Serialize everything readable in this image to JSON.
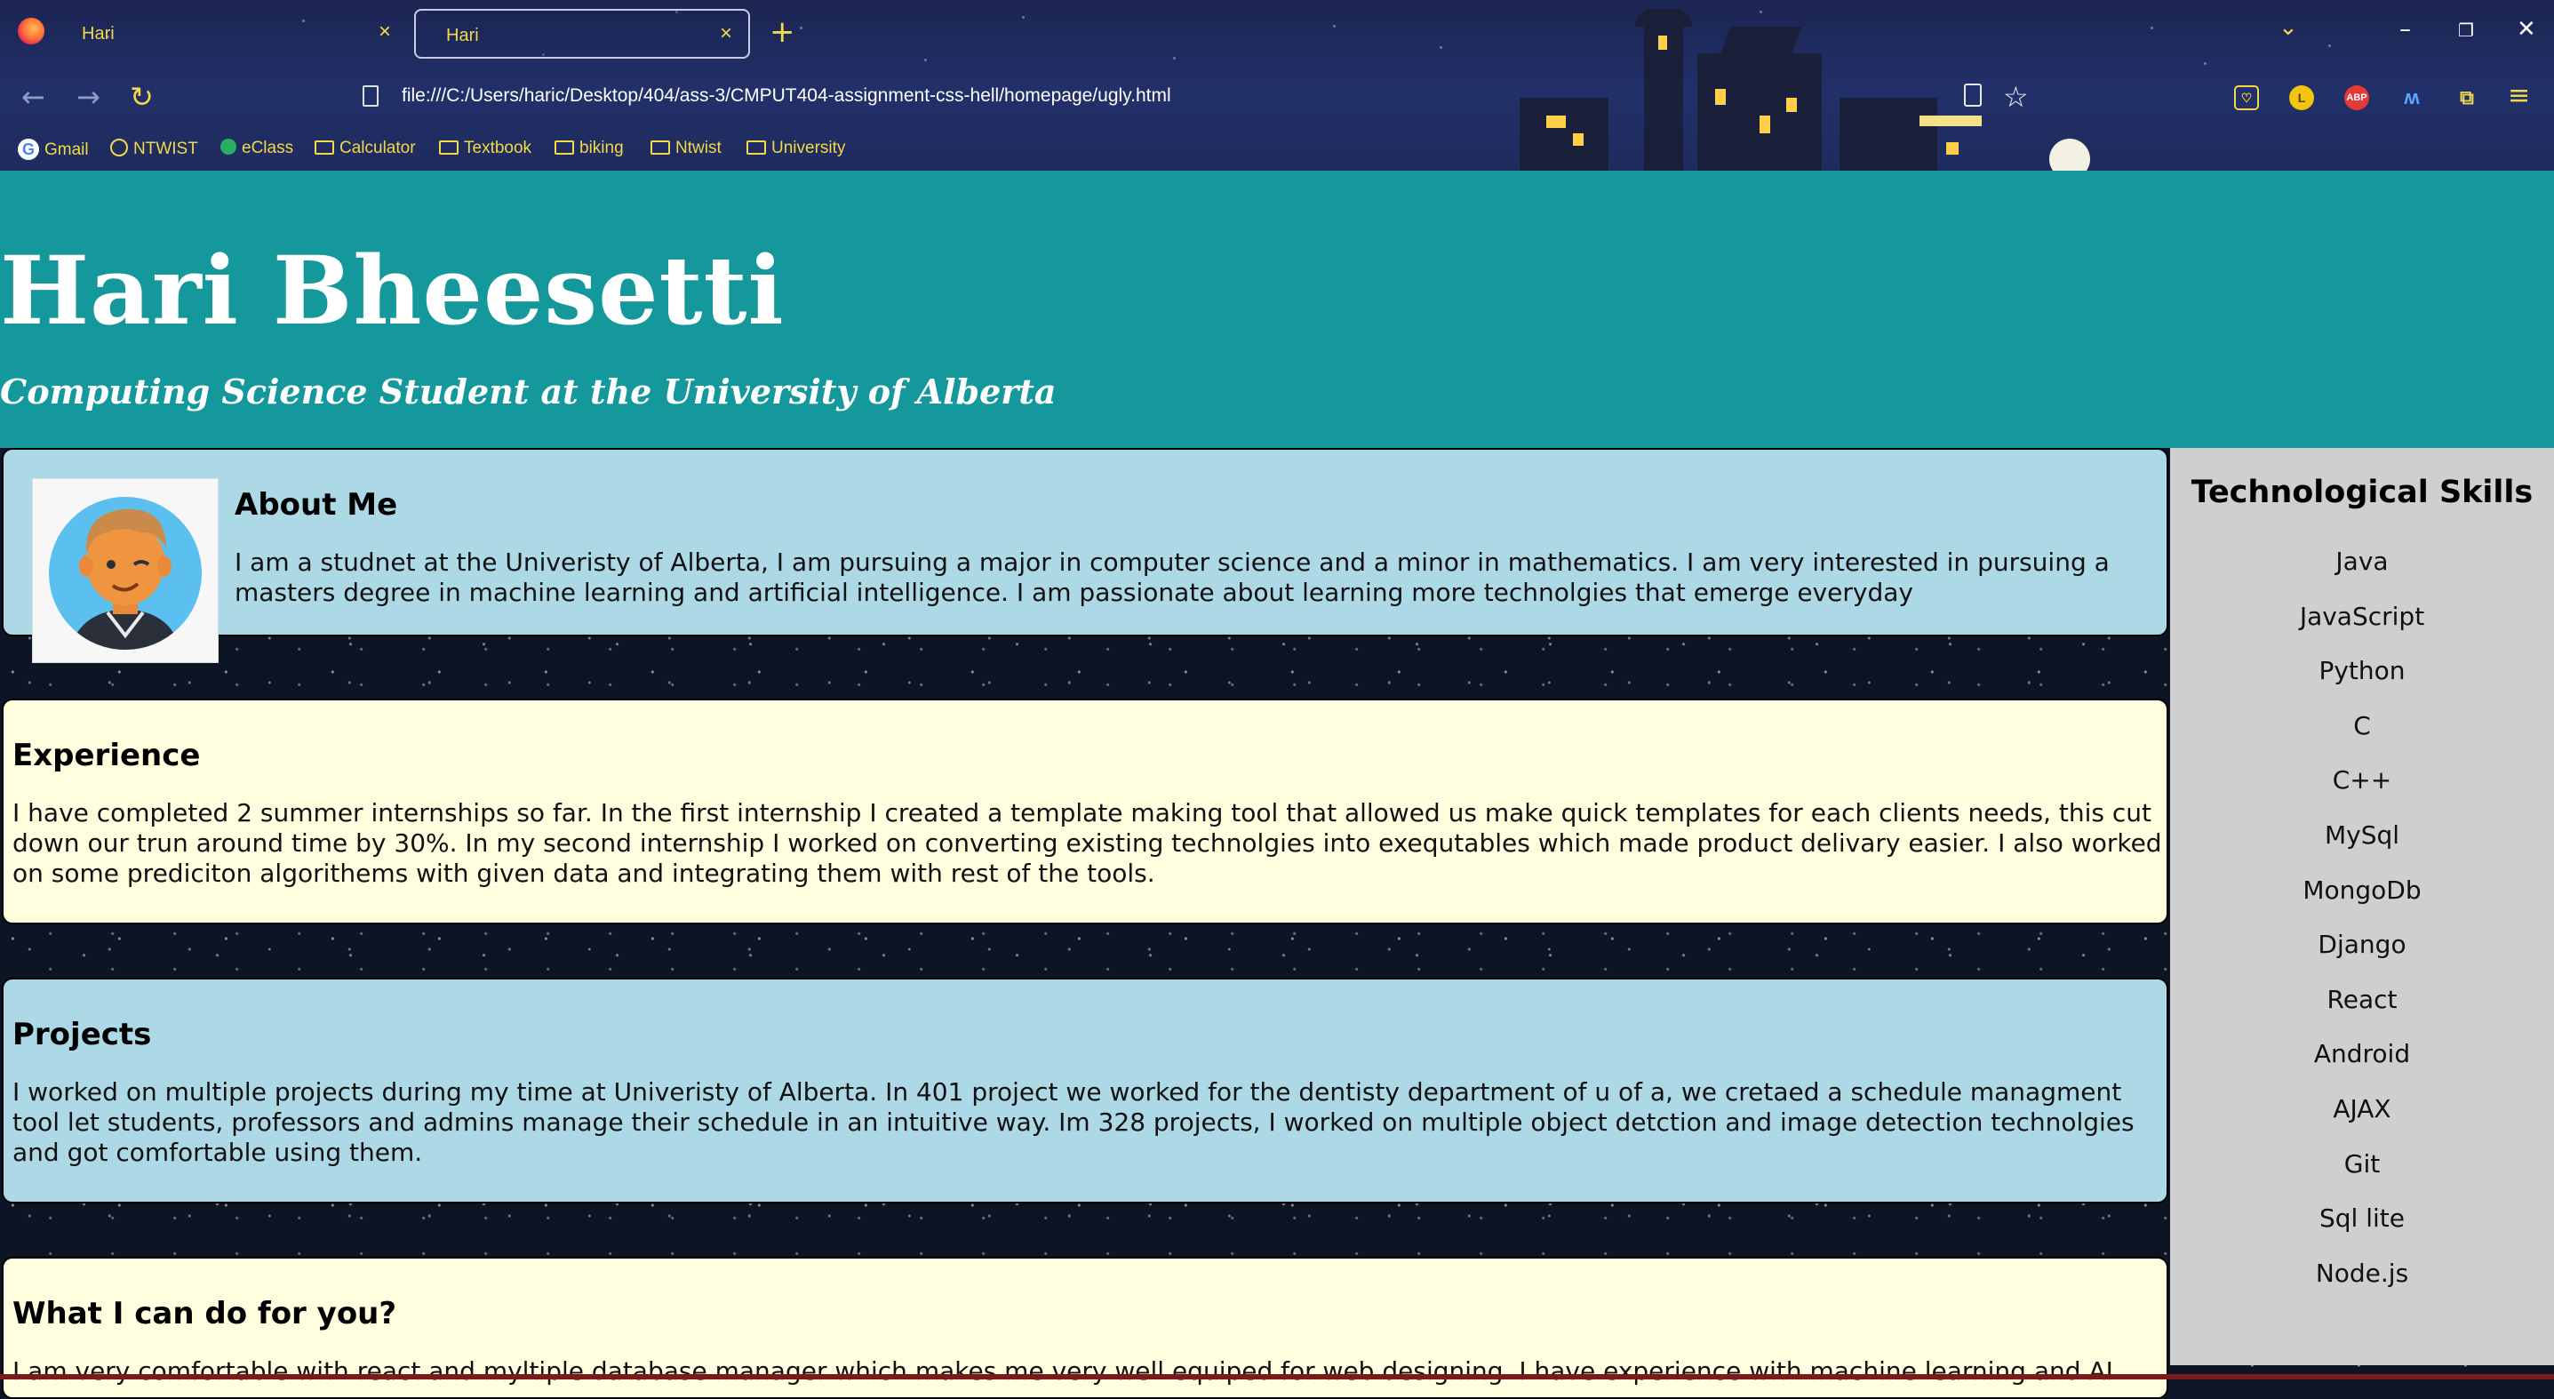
{
  "browser": {
    "tabs": [
      {
        "title": "Hari",
        "active": false
      },
      {
        "title": "Hari",
        "active": true
      }
    ],
    "url": "file:///C:/Users/haric/Desktop/404/ass-3/CMPUT404-assignment-css-hell/homepage/ugly.html",
    "bookmarks": [
      "Gmail",
      "NTWIST",
      "eClass",
      "Calculator",
      "Textbook",
      "biking",
      "Ntwist",
      "University"
    ],
    "extensions": {
      "l_badge": "L",
      "abp_badge": "ABP"
    },
    "accent_color": "#f1d94a"
  },
  "page": {
    "name": "Hari Bheesetti",
    "tagline": "Computing Science Student at the University of Alberta",
    "banner_color": "#15989c",
    "about": {
      "heading": "About Me",
      "text": "I am a studnet at the Univeristy of Alberta, I am pursuing a major in computer science and a minor in mathematics. I am very interested in pursuing a masters degree in machine learning and artificial intelligence. I am passionate about learning more technolgies that emerge everyday"
    },
    "experience": {
      "heading": "Experience",
      "text": "I have completed 2 summer internships so far. In the first internship I created a template making tool that allowed us make quick templates for each clients needs, this cut down our trun around time by 30%. In my second internship I worked on converting existing technolgies into exequtables which made product delivary easier. I also worked on some prediciton algorithems with given data and integrating them with rest of the tools."
    },
    "projects": {
      "heading": "Projects",
      "text": "I worked on multiple projects during my time at Univeristy of Alberta. In 401 project we worked for the dentisty department of u of a, we cretaed a schedule managment tool let students, professors and admins manage their schedule in an intuitive way. Im 328 projects, I worked on multiple object detction and image detection technolgies and got comfortable using them."
    },
    "cando": {
      "heading": "What I can do for you?",
      "text": "I am very comfortable with react and myltiple database manager which makes me very well equiped for web designing. I have experience with machine learning and AI"
    },
    "skills": {
      "heading": "Technological Skills",
      "items": [
        "Java",
        "JavaScript",
        "Python",
        "C",
        "C++",
        "MySql",
        "MongoDb",
        "Django",
        "React",
        "Android",
        "AJAX",
        "Git",
        "Sql lite",
        "Node.js"
      ]
    }
  }
}
